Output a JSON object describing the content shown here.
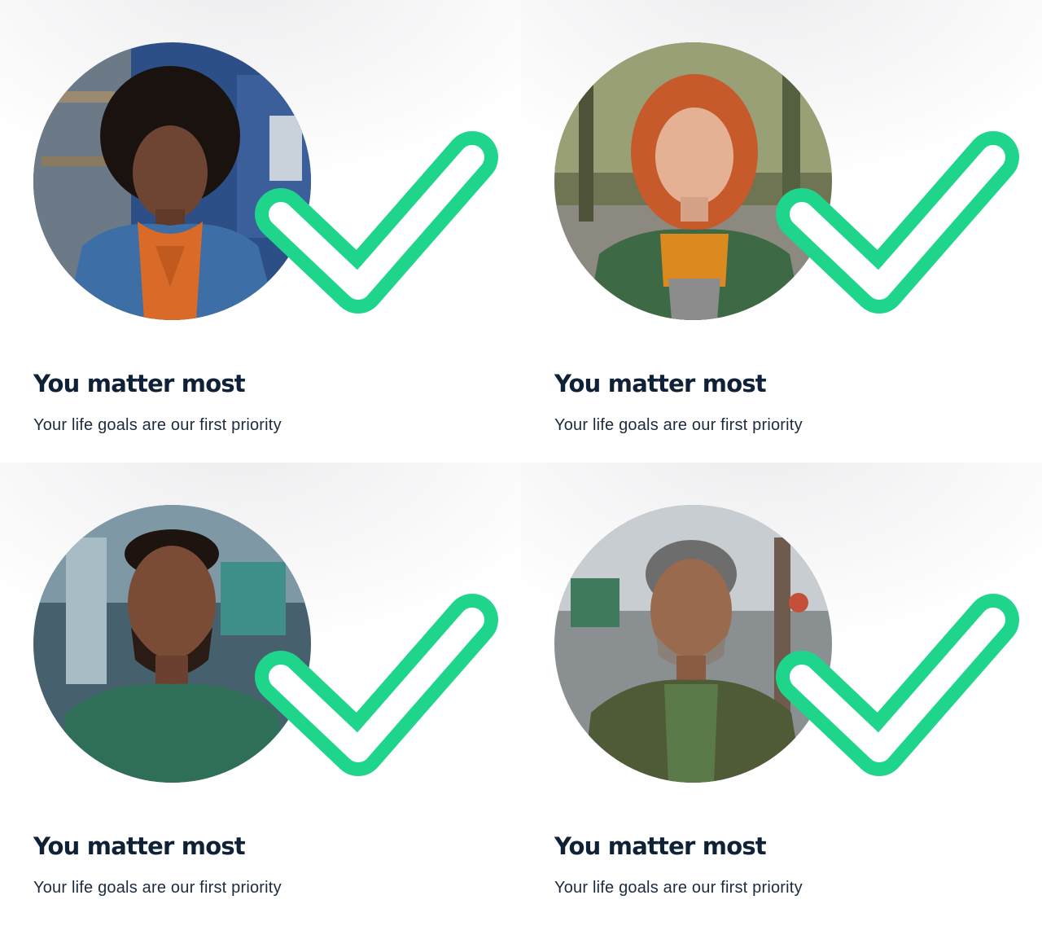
{
  "accent_color": "#1fd58b",
  "heading_color": "#0f2137",
  "cards": [
    {
      "image": "portrait-woman-curly-hair-orange-scarf",
      "icon": "checkmark-icon",
      "title": "You matter most",
      "subtitle": "Your life goals are our first priority"
    },
    {
      "image": "portrait-woman-red-hair-orange-scarf",
      "icon": "checkmark-icon",
      "title": "You matter most",
      "subtitle": "Your life goals are our first priority"
    },
    {
      "image": "portrait-man-green-shirt",
      "icon": "checkmark-icon",
      "title": "You matter most",
      "subtitle": "Your life goals are our first priority"
    },
    {
      "image": "portrait-man-grey-hair-green-jacket",
      "icon": "checkmark-icon",
      "title": "You matter most",
      "subtitle": "Your life goals are our first priority"
    }
  ]
}
